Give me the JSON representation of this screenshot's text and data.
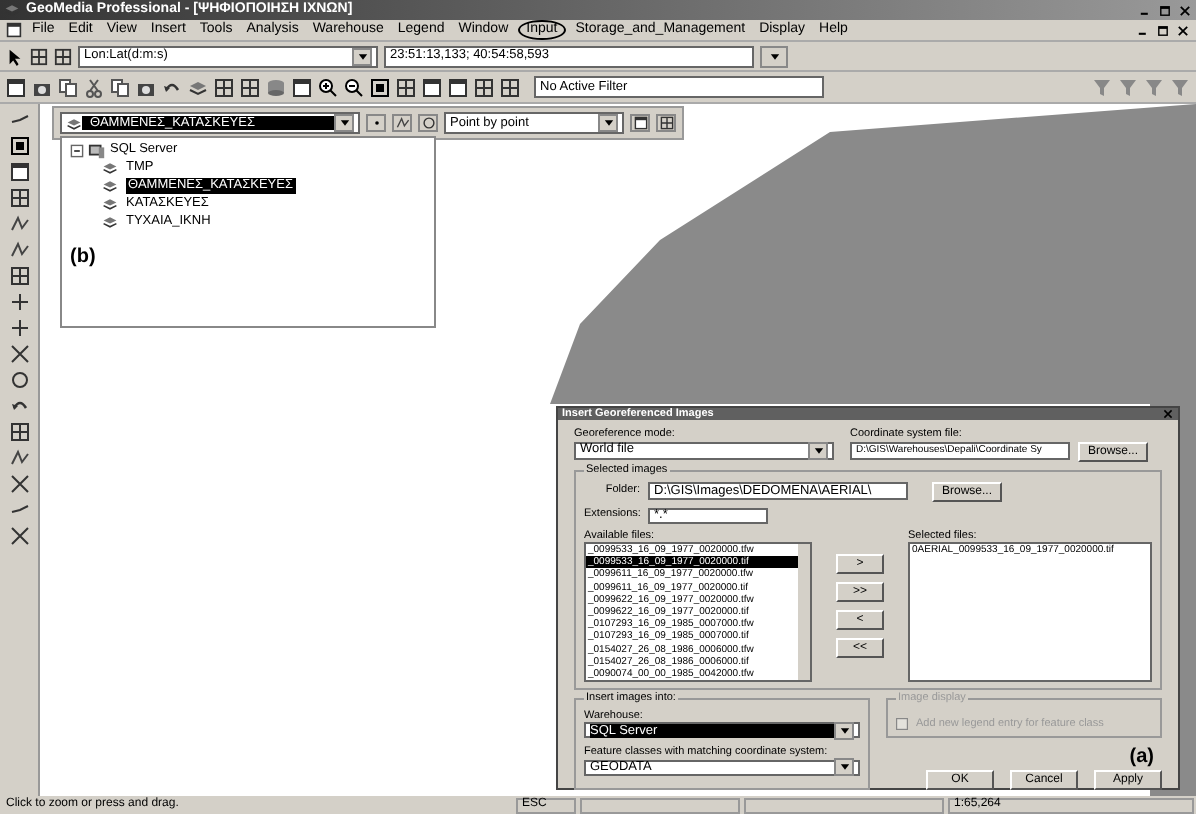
{
  "window": {
    "title": "GeoMedia Professional - [ΨΗΦΙΟΠΟΙΗΣΗ ΙΧΝΩΝ]"
  },
  "menu": [
    {
      "label": "File",
      "circled": false
    },
    {
      "label": "Edit",
      "circled": false
    },
    {
      "label": "View",
      "circled": false
    },
    {
      "label": "Insert",
      "circled": false
    },
    {
      "label": "Tools",
      "circled": false
    },
    {
      "label": "Analysis",
      "circled": false
    },
    {
      "label": "Warehouse",
      "circled": false
    },
    {
      "label": "Legend",
      "circled": false
    },
    {
      "label": "Window",
      "circled": false
    },
    {
      "label": "Input",
      "circled": true
    },
    {
      "label": "Storage_and_Management",
      "circled": false
    },
    {
      "label": "Display",
      "circled": false
    },
    {
      "label": "Help",
      "circled": false
    }
  ],
  "toolbar": {
    "coordinate_system": "Lon:Lat(d:m:s)",
    "coordinates": "23:51:13,133; 40:54:58,593",
    "filter": "No Active Filter"
  },
  "legend_bar": {
    "feature_class": "ΘΑΜΜΕΝΕΣ_ΚΑΤΑΣΚΕΥΕΣ",
    "placement_mode": "Point by point"
  },
  "tree": {
    "root": "SQL Server",
    "expanded": true,
    "annotation": "(b)",
    "children": [
      {
        "label": "TMP",
        "selected": false
      },
      {
        "label": "ΘΑΜΜΕΝΕΣ_ΚΑΤΑΣΚΕΥΕΣ",
        "selected": true
      },
      {
        "label": "ΚΑΤΑΣΚΕΥΕΣ",
        "selected": false
      },
      {
        "label": "ΤΥΧΑΙΑ_ΙΚΝΗ",
        "selected": false
      }
    ]
  },
  "dialog": {
    "title": "Insert Georeferenced Images",
    "mode_label": "Georeference mode:",
    "mode": "World file",
    "csf_label": "Coordinate system file:",
    "csf": "D:\\GIS\\Warehouses\\Depali\\Coordinate Sy",
    "browse": "Browse...",
    "selected_group": "Selected images",
    "folder_label": "Folder:",
    "folder": "D:\\GIS\\Images\\DEDOMENA\\AERIAL\\",
    "folder_browse": "Browse...",
    "ext_label": "Extensions:",
    "ext": "*.*",
    "available_label": "Available files:",
    "available": [
      {
        "name": "_0099533_16_09_1977_0020000.tfw",
        "selected": false
      },
      {
        "name": "_0099533_16_09_1977_0020000.tif",
        "selected": true
      },
      {
        "name": "_0099611_16_09_1977_0020000.tfw",
        "selected": false
      },
      {
        "name": "_0099611_16_09_1977_0020000.tif",
        "selected": false
      },
      {
        "name": "_0099622_16_09_1977_0020000.tfw",
        "selected": false
      },
      {
        "name": "_0099622_16_09_1977_0020000.tif",
        "selected": false
      },
      {
        "name": "_0107293_16_09_1985_0007000.tfw",
        "selected": false
      },
      {
        "name": "_0107293_16_09_1985_0007000.tif",
        "selected": false
      },
      {
        "name": "_0154027_26_08_1986_0006000.tfw",
        "selected": false
      },
      {
        "name": "_0154027_26_08_1986_0006000.tif",
        "selected": false
      },
      {
        "name": "_0090074_00_00_1985_0042000.tfw",
        "selected": false
      }
    ],
    "move_buttons": [
      ">",
      ">>",
      "<",
      "<<"
    ],
    "selected_label": "Selected files:",
    "selected_files": [
      "0AERIAL_0099533_16_09_1977_0020000.tif"
    ],
    "insert_group": "Insert images into:",
    "warehouse_label": "Warehouse:",
    "warehouse": "SQL Server",
    "fc_label": "Feature classes with matching coordinate system:",
    "fc": "GEODATA",
    "display_group": "Image display",
    "display_disabled": true,
    "legend_check": {
      "label": "Add new legend entry for feature class",
      "checked": false,
      "disabled": true
    },
    "annotation": "(a)",
    "buttons": [
      "OK",
      "Cancel",
      "Apply"
    ]
  },
  "status_bar": {
    "prompt": "Click to zoom or press and drag.",
    "key": "ESC",
    "scale": "1:65,264"
  }
}
